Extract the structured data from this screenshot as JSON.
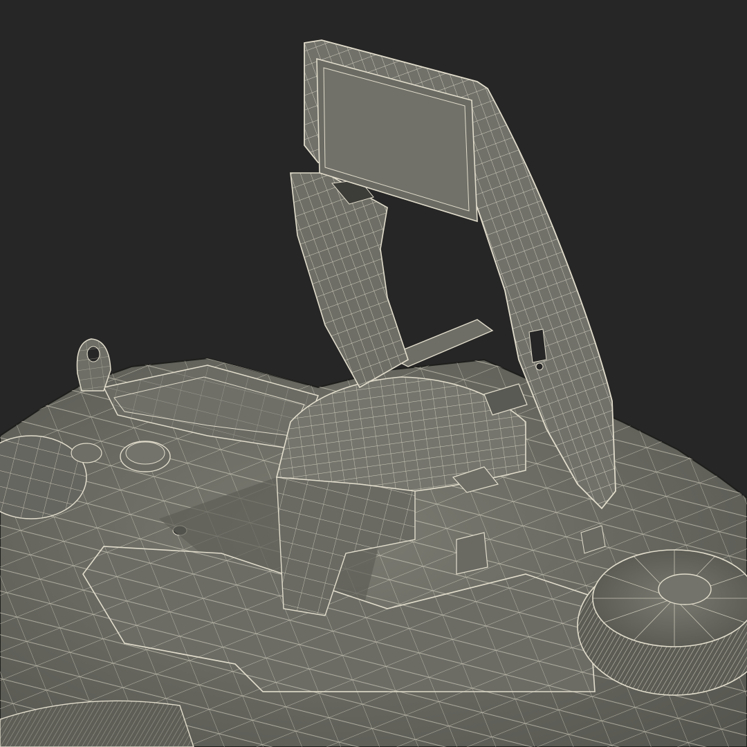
{
  "scene": {
    "subject": "wireframe-render-camera-top-flash-up",
    "background_color": "#262626",
    "surface_color": "#6e6e66",
    "surface_light_color": "#7c7c73",
    "surface_dark_color": "#55554f",
    "shadow_color": "#1e1e1c",
    "wire_color": "#e2ddcc",
    "panel_color": "#6b6b64"
  }
}
